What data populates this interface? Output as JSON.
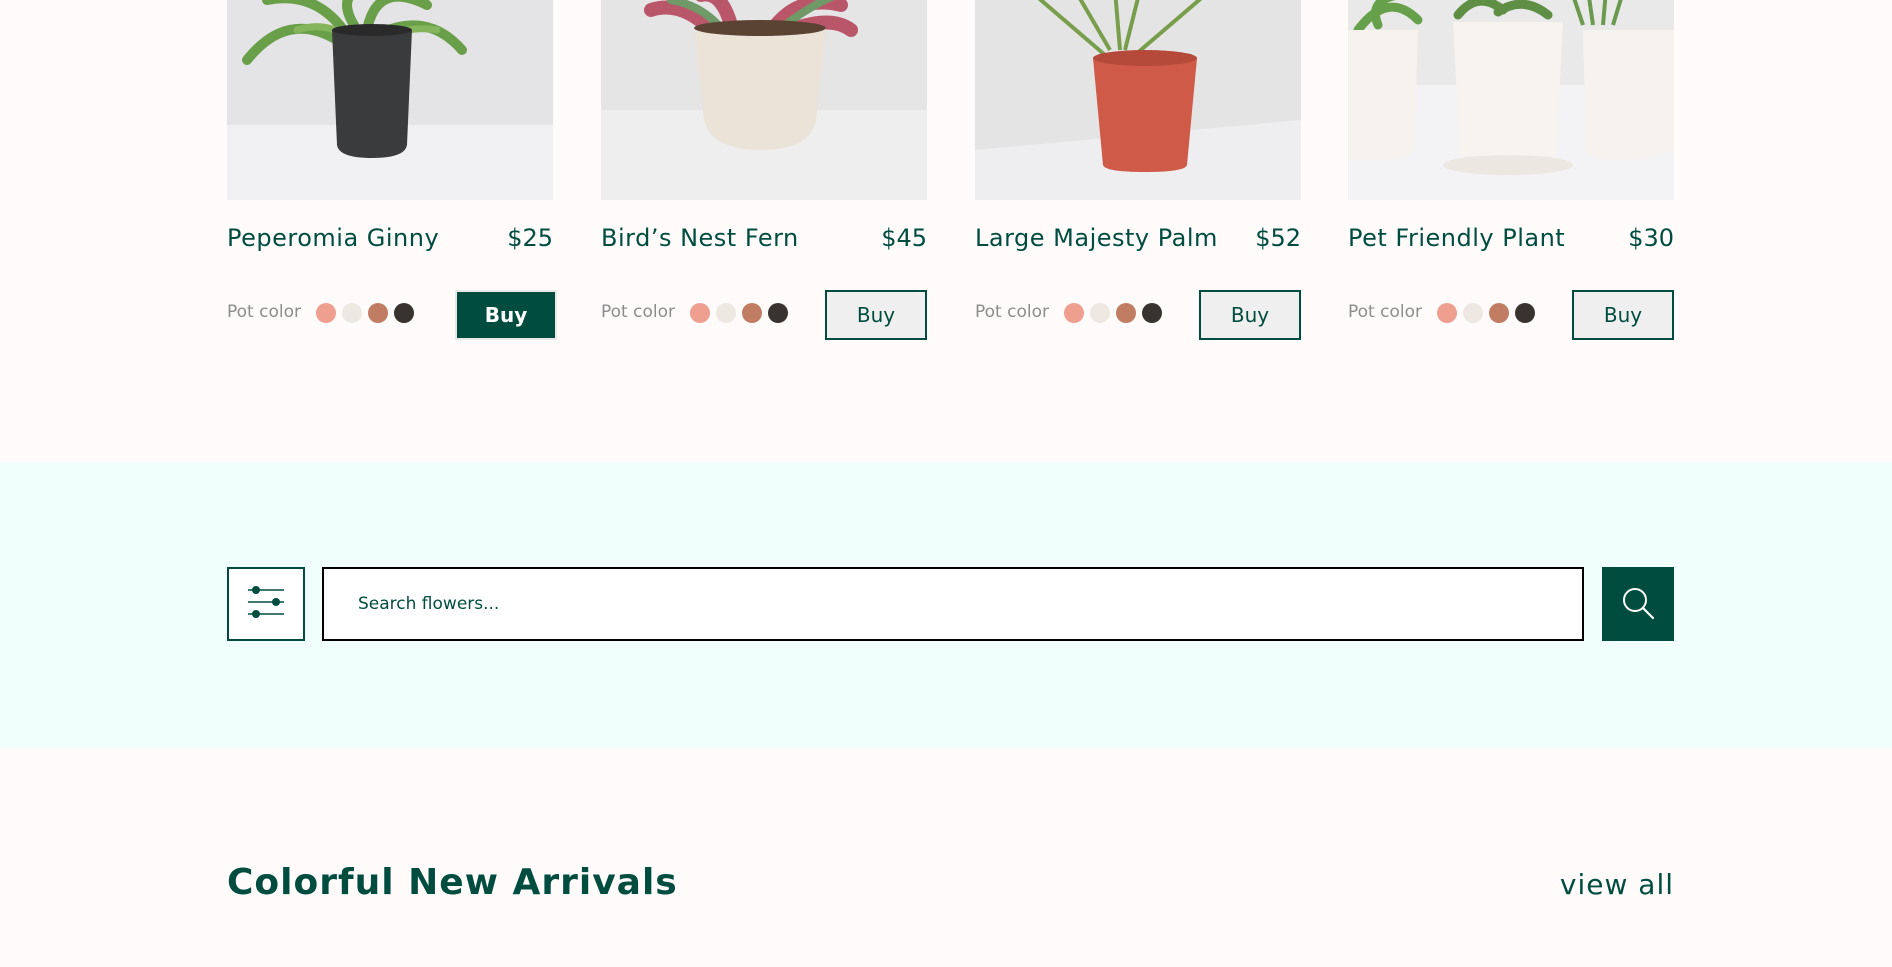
{
  "products": [
    {
      "name": "Peperomia Ginny",
      "price": "$25",
      "pot_label": "Pot color",
      "buy_label": "Buy",
      "buy_active": true
    },
    {
      "name": "Bird’s Nest Fern",
      "price": "$45",
      "pot_label": "Pot color",
      "buy_label": "Buy",
      "buy_active": false
    },
    {
      "name": "Large Majesty Palm",
      "price": "$52",
      "pot_label": "Pot color",
      "buy_label": "Buy",
      "buy_active": false
    },
    {
      "name": "Pet Friendly Plant",
      "price": "$30",
      "pot_label": "Pot color",
      "buy_label": "Buy",
      "buy_active": false
    }
  ],
  "pot_colors": [
    "#ef9f8f",
    "#eee8e3",
    "#c07d63",
    "#38332f"
  ],
  "search": {
    "placeholder": "Search flowers...",
    "filter_icon": "sliders-icon",
    "search_icon": "search-icon"
  },
  "arrivals": {
    "title": "Colorful New Arrivals",
    "view_all": "view all"
  },
  "colors": {
    "brand": "#004d40",
    "band": "#f0fffb",
    "page": "#fffbfb"
  }
}
